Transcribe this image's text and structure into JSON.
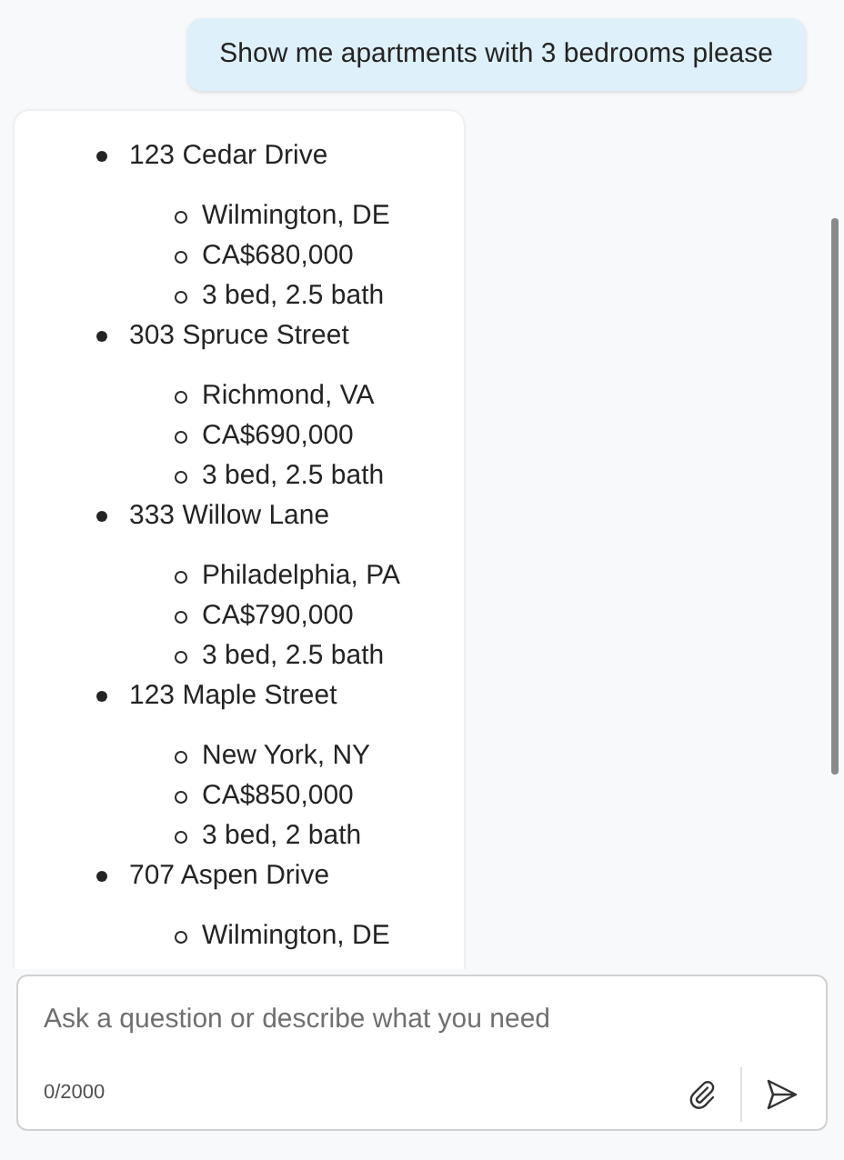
{
  "user_message": "Show me apartments with 3 bedrooms please",
  "listings": [
    {
      "title": "123 Cedar Drive",
      "details": [
        "Wilmington, DE",
        "CA$680,000",
        "3 bed, 2.5 bath"
      ]
    },
    {
      "title": "303 Spruce Street",
      "details": [
        "Richmond, VA",
        "CA$690,000",
        "3 bed, 2.5 bath"
      ]
    },
    {
      "title": "333 Willow Lane",
      "details": [
        "Philadelphia, PA",
        "CA$790,000",
        "3 bed, 2.5 bath"
      ]
    },
    {
      "title": "123 Maple Street",
      "details": [
        "New York, NY",
        "CA$850,000",
        "3 bed, 2 bath"
      ]
    },
    {
      "title": "707 Aspen Drive",
      "details": [
        "Wilmington, DE"
      ]
    }
  ],
  "composer": {
    "placeholder": "Ask a question or describe what you need",
    "counter": "0/2000"
  }
}
